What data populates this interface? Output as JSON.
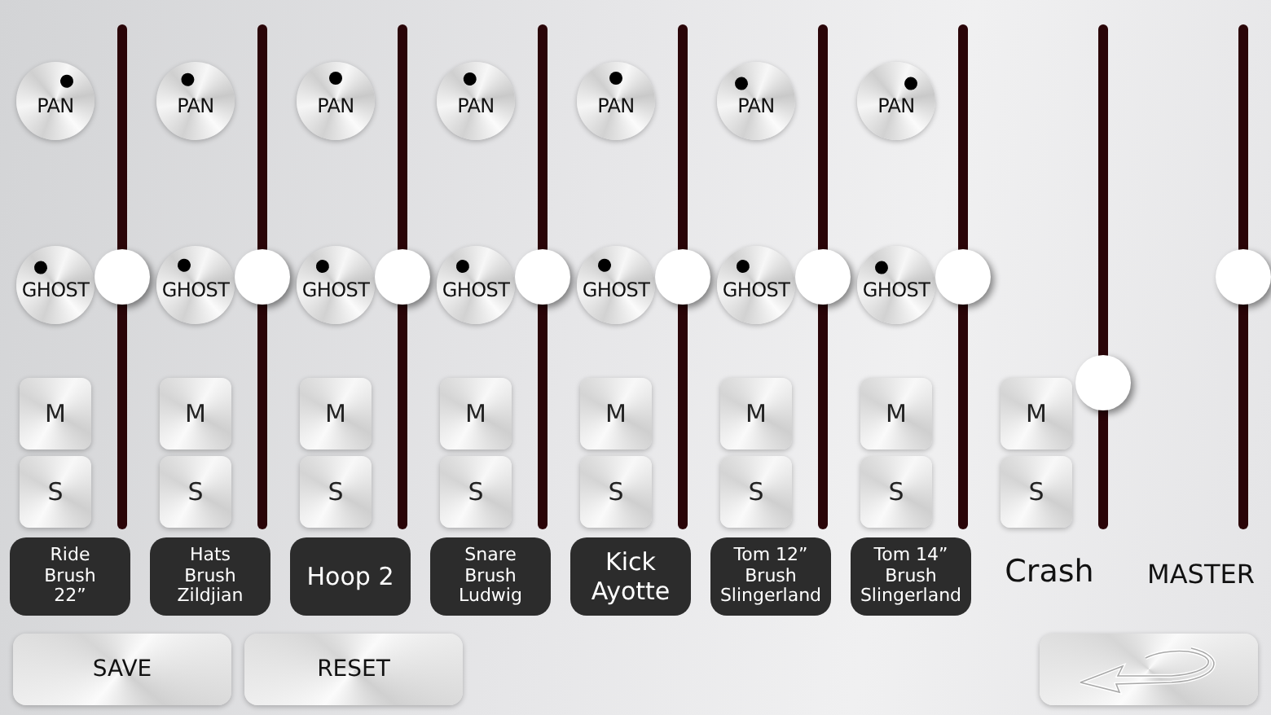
{
  "channels": [
    {
      "kind": "drum",
      "name": "Ride\nBrush\n22”",
      "pan": {
        "label": "PAN"
      },
      "ghost": {
        "label": "GHOST"
      },
      "mute": "M",
      "solo": "S",
      "fader": {
        "level": 0.5
      }
    },
    {
      "kind": "drum",
      "name": "Hats\nBrush\nZildjian",
      "pan": {
        "label": "PAN"
      },
      "ghost": {
        "label": "GHOST"
      },
      "mute": "M",
      "solo": "S",
      "fader": {
        "level": 0.5
      }
    },
    {
      "kind": "drum",
      "name": "Hoop 2",
      "pan": {
        "label": "PAN"
      },
      "ghost": {
        "label": "GHOST"
      },
      "mute": "M",
      "solo": "S",
      "fader": {
        "level": 0.5
      }
    },
    {
      "kind": "drum",
      "name": "Snare\nBrush\nLudwig",
      "pan": {
        "label": "PAN"
      },
      "ghost": {
        "label": "GHOST"
      },
      "mute": "M",
      "solo": "S",
      "fader": {
        "level": 0.5
      }
    },
    {
      "kind": "drum",
      "name": "Kick\nAyotte",
      "pan": {
        "label": "PAN"
      },
      "ghost": {
        "label": "GHOST"
      },
      "mute": "M",
      "solo": "S",
      "fader": {
        "level": 0.5
      }
    },
    {
      "kind": "drum",
      "name": "Tom 12”\nBrush\nSlingerland",
      "pan": {
        "label": "PAN"
      },
      "ghost": {
        "label": "GHOST"
      },
      "mute": "M",
      "solo": "S",
      "fader": {
        "level": 0.5
      }
    },
    {
      "kind": "drum",
      "name": "Tom 14”\nBrush\nSlingerland",
      "pan": {
        "label": "PAN"
      },
      "ghost": {
        "label": "GHOST"
      },
      "mute": "M",
      "solo": "S",
      "fader": {
        "level": 0.5
      }
    },
    {
      "kind": "cymbal",
      "name": "Crash",
      "mute": "M",
      "solo": "S",
      "fader": {
        "level": 0.29
      }
    },
    {
      "kind": "master",
      "name": "MASTER",
      "fader": {
        "level": 0.5
      }
    }
  ],
  "buttons": [
    {
      "kind": "text",
      "label": "SAVE"
    },
    {
      "kind": "text",
      "label": "RESET"
    },
    {
      "kind": "back"
    }
  ]
}
